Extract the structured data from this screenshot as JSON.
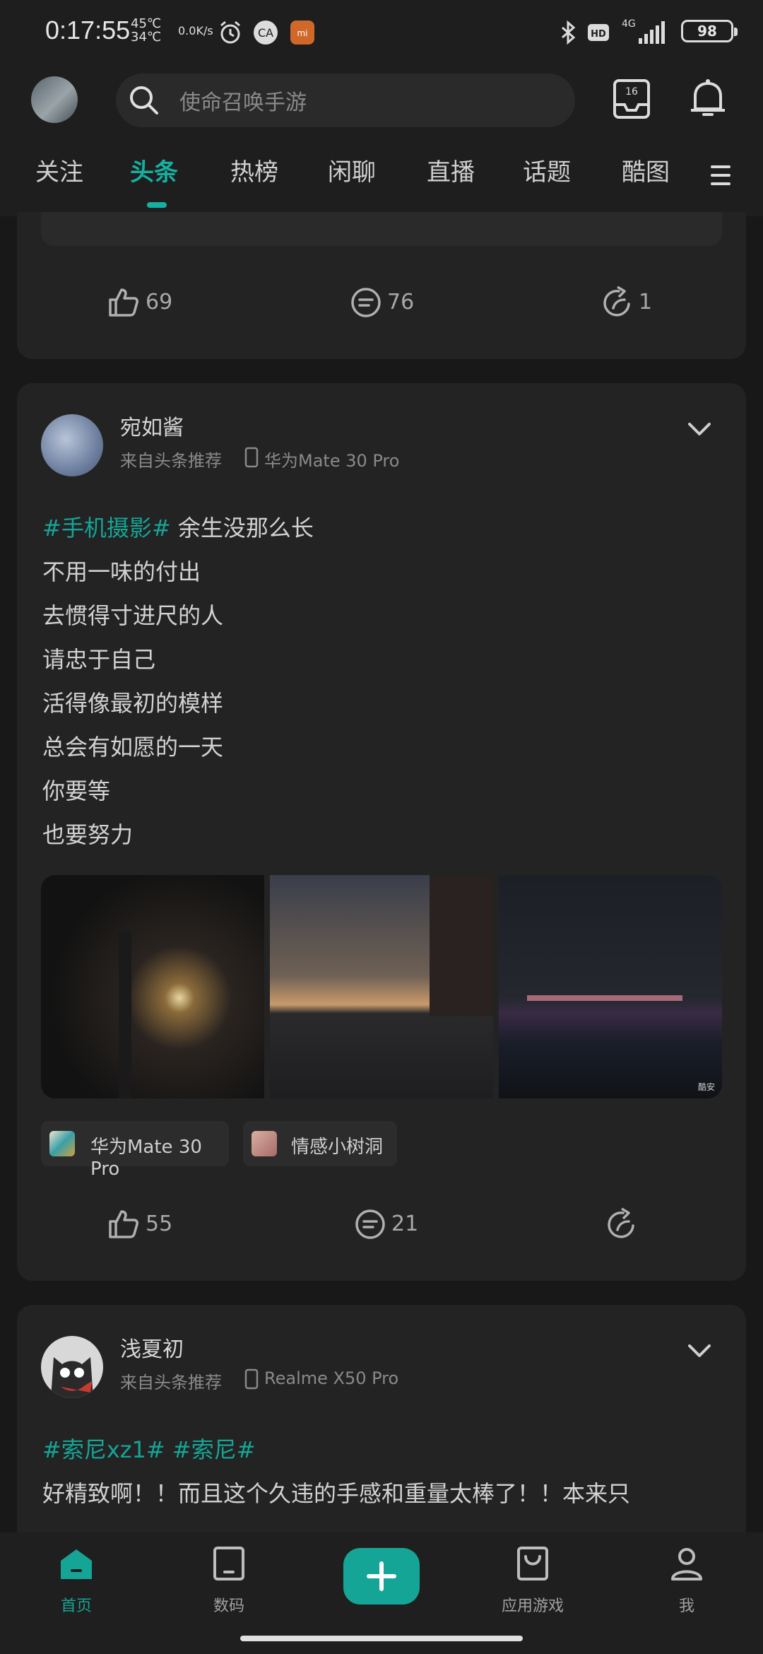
{
  "status_bar": {
    "time": "0:17:55",
    "temp_high": "45℃",
    "temp_low": "34℃",
    "net_speed": "0.0K/s",
    "network": "4G",
    "hd": "HD",
    "battery": "98"
  },
  "header": {
    "search_placeholder": "使命召唤手游",
    "inbox_badge": "16"
  },
  "tabs": [
    "关注",
    "头条",
    "热榜",
    "闲聊",
    "直播",
    "话题",
    "酷图"
  ],
  "active_tab": "头条",
  "prev_post": {
    "likes": "69",
    "comments": "76",
    "shares": "1"
  },
  "post1": {
    "username": "宛如酱",
    "source": "来自头条推荐",
    "device": "华为Mate 30 Pro",
    "hashtag": "#手机摄影#",
    "lines": [
      "余生没那么长",
      "不用一味的付出",
      "去惯得寸进尺的人",
      "请忠于自己",
      "活得像最初的模样",
      "总会有如愿的一天",
      "你要等",
      "也要努力"
    ],
    "watermark": "酷安",
    "chips": [
      "华为Mate 30 Pro",
      "情感小树洞"
    ],
    "likes": "55",
    "comments": "21"
  },
  "post2": {
    "username": "浅夏初",
    "source": "来自头条推荐",
    "device": "Realme X50 Pro",
    "hashtags": "#索尼xz1# #索尼#",
    "text": "好精致啊！！而且这个久违的手感和重量太棒了！！本来只"
  },
  "bottom_nav": {
    "items": [
      "首页",
      "数码",
      "应用游戏",
      "我"
    ],
    "active": "首页"
  },
  "colors": {
    "accent": "#14a596",
    "background": "#181818",
    "card": "#232323"
  }
}
